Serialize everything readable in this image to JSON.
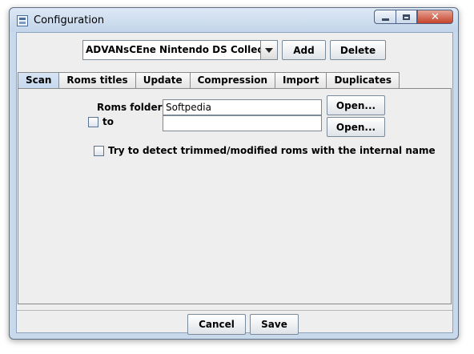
{
  "window": {
    "title": "Configuration",
    "close_glyph": "✕"
  },
  "toolbar": {
    "collection_value": "ADVANsCEne Nintendo DS Collection",
    "add_label": "Add",
    "delete_label": "Delete"
  },
  "tabs": [
    {
      "label": "Scan",
      "active": true
    },
    {
      "label": "Roms titles",
      "active": false
    },
    {
      "label": "Update",
      "active": false
    },
    {
      "label": "Compression",
      "active": false
    },
    {
      "label": "Import",
      "active": false
    },
    {
      "label": "Duplicates",
      "active": false
    }
  ],
  "scan": {
    "roms_folders_label": "Roms folders",
    "roms_folders_value": "Softpedia",
    "to_label": "to",
    "to_value": "",
    "open_label": "Open...",
    "trimmed_label": "Try to detect trimmed/modified roms with the internal name"
  },
  "footer": {
    "cancel_label": "Cancel",
    "save_label": "Save"
  },
  "icons": {
    "app": "app-window-icon",
    "dropdown": "chevron-down-icon"
  },
  "colors": {
    "active_tab": "#c7d9ef",
    "close_button": "#c6432a",
    "frame": "#c9d9ec"
  }
}
